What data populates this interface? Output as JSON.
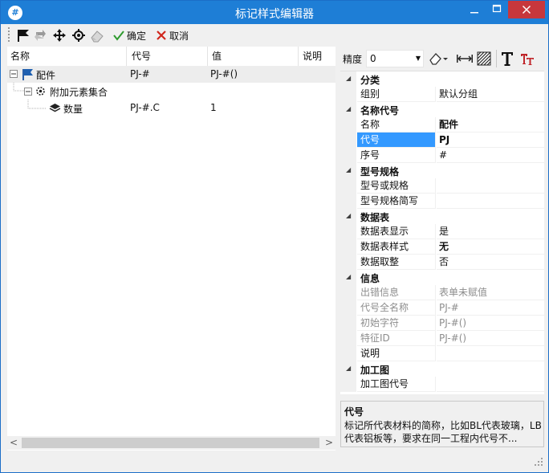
{
  "window": {
    "app_icon": "#",
    "title": "标记样式编辑器",
    "minimize_icon": "minimize-icon",
    "maximize_icon": "maximize-icon",
    "close_icon": "close-icon"
  },
  "toolbar": {
    "icons": [
      "flag-icon",
      "refresh-icon",
      "move-icon",
      "target-icon",
      "eraser-icon"
    ],
    "confirm_label": "确定",
    "cancel_label": "取消"
  },
  "tree": {
    "columns": [
      "名称",
      "代号",
      "值",
      "说明"
    ],
    "rows": [
      {
        "name": "配件",
        "code": "PJ-#",
        "value": "PJ-#()",
        "icon": "flag-icon"
      },
      {
        "name": "附加元素集合",
        "code": "",
        "value": "",
        "icon": "gear-icon"
      },
      {
        "name": "数量",
        "code": "PJ-#.C",
        "value": "1",
        "icon": "layers-icon"
      }
    ],
    "scroll_left": "<",
    "scroll_right": ">"
  },
  "props_toolbar": {
    "precision_label": "精度",
    "precision_value": "0",
    "icons": [
      "eraser-dropdown-icon",
      "width-icon",
      "hatch-icon",
      "text-icon",
      "text-style-icon"
    ]
  },
  "grid": {
    "categories": [
      {
        "label": "分类",
        "rows": [
          {
            "name": "组别",
            "value": "默认分组"
          }
        ]
      },
      {
        "label": "名称代号",
        "rows": [
          {
            "name": "名称",
            "value": "配件",
            "bold": true
          },
          {
            "name": "代号",
            "value": "PJ",
            "bold": true,
            "selected": true
          },
          {
            "name": "序号",
            "value": "#"
          }
        ]
      },
      {
        "label": "型号规格",
        "rows": [
          {
            "name": "型号或规格",
            "value": ""
          },
          {
            "name": "型号规格简写",
            "value": ""
          }
        ]
      },
      {
        "label": "数据表",
        "rows": [
          {
            "name": "数据表显示",
            "value": "是"
          },
          {
            "name": "数据表样式",
            "value": "无",
            "bold": true
          },
          {
            "name": "数据取整",
            "value": "否"
          }
        ]
      },
      {
        "label": "信息",
        "rows": [
          {
            "name": "出错信息",
            "value": "表单未赋值",
            "dim": true
          },
          {
            "name": "代号全名称",
            "value": "PJ-#",
            "dim": true
          },
          {
            "name": "初始字符",
            "value": "PJ-#()",
            "dim": true
          },
          {
            "name": "特征ID",
            "value": "PJ-#()",
            "dim": true
          },
          {
            "name": "说明",
            "value": ""
          }
        ]
      },
      {
        "label": "加工图",
        "rows": [
          {
            "name": "加工图代号",
            "value": ""
          }
        ]
      }
    ]
  },
  "description": {
    "title": "代号",
    "text": "标记所代表材料的简称，比如BL代表玻璃，LB代表铝板等，要求在同一工程内代号不..."
  },
  "colors": {
    "titlebar": "#1e7ed6",
    "close": "#c7373c",
    "selection": "#3399ff"
  }
}
